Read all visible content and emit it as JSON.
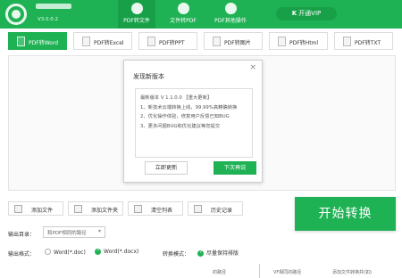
{
  "header": {
    "version": "V3.0.0.2",
    "tabs": [
      {
        "label": "PDF转文件",
        "active": true
      },
      {
        "label": "文件转PDF",
        "active": false
      },
      {
        "label": "PDF其他操作",
        "active": false
      }
    ],
    "vip_label": "开通VIP",
    "brand_color": "#1fb254"
  },
  "type_tabs": [
    "PDF转Word",
    "PDF转Excel",
    "PDF转PPT",
    "PDF转图片",
    "PDF转Html",
    "PDF转TXT"
  ],
  "dialog": {
    "title": "发现新版本",
    "close": "×",
    "lines": [
      "最新版本 V 1.1.0.0 【重大更新】",
      "1、新技术云端转换上线，99.99%高精确转换",
      "2、优化操作体验，修复用户反馈已知BUG",
      "3、更多问题BUG和优化建议等您提交"
    ],
    "update_btn": "立即更新",
    "later_btn": "下次再说"
  },
  "actions": [
    "添加文件",
    "添加文件夹",
    "清空列表",
    "历史记录"
  ],
  "start_btn": "开始转换",
  "output": {
    "dir_label": "输出目录：",
    "dir_value": "和PDF相同的路径",
    "fmt_label": "输出格式：",
    "formats": [
      {
        "label": "Word(*.doc)",
        "checked": false
      },
      {
        "label": "Word(*.docx)",
        "checked": true
      }
    ],
    "mode_label": "转换模式：",
    "mode_value": "尽量保持排版"
  },
  "bottom": {
    "left_text": "的路径",
    "mid_text": "VF相同的路径",
    "right_text": "添加文件转换并(如)"
  }
}
